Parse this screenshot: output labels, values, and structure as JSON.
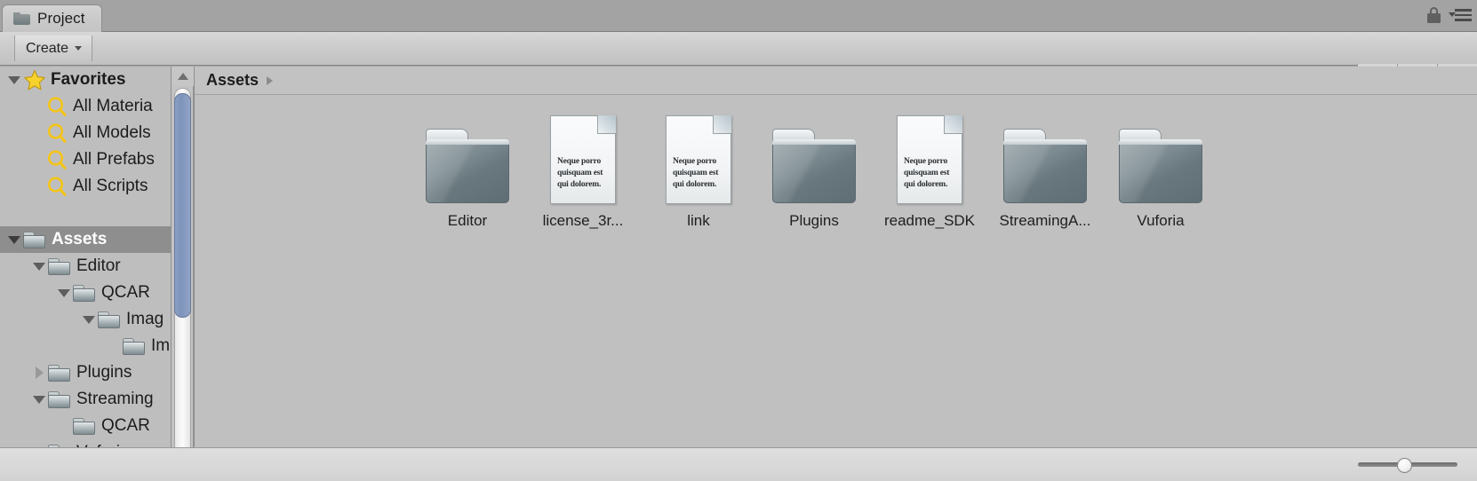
{
  "window": {
    "tab_label": "Project",
    "tab_icon": "folder-icon",
    "lock_icon": "lock-icon",
    "menu_icon": "hamburger-menu-icon"
  },
  "toolbar": {
    "create_label": "Create",
    "create_caret": "chevron-down-icon",
    "search": {
      "value": "",
      "placeholder": "",
      "icon": "search-icon"
    },
    "buttons": [
      {
        "name": "filter-by-type-button",
        "icon": "shapes-icon"
      },
      {
        "name": "filter-by-label-button",
        "icon": "tag-icon"
      },
      {
        "name": "filter-favorites-button",
        "icon": "star-icon"
      }
    ]
  },
  "sidebar": {
    "scrollbar": {
      "up_arrow": "scroll-up-arrow",
      "down_arrow": "scroll-down-arrow"
    },
    "items": [
      {
        "label": "Favorites",
        "icon": "star-icon",
        "indent": 0,
        "twisty": "open",
        "bold": true,
        "selected": false
      },
      {
        "label": "All Materia",
        "icon": "search-icon",
        "indent": 1,
        "twisty": "none",
        "bold": false,
        "selected": false
      },
      {
        "label": "All Models",
        "icon": "search-icon",
        "indent": 1,
        "twisty": "none",
        "bold": false,
        "selected": false
      },
      {
        "label": "All Prefabs",
        "icon": "search-icon",
        "indent": 1,
        "twisty": "none",
        "bold": false,
        "selected": false
      },
      {
        "label": "All Scripts",
        "icon": "search-icon",
        "indent": 1,
        "twisty": "none",
        "bold": false,
        "selected": false
      },
      {
        "label": "",
        "icon": "none",
        "indent": 0,
        "twisty": "none",
        "bold": false,
        "selected": false
      },
      {
        "label": "Assets",
        "icon": "folder-icon",
        "indent": 0,
        "twisty": "open",
        "bold": true,
        "selected": true
      },
      {
        "label": "Editor",
        "icon": "folder-icon",
        "indent": 1,
        "twisty": "open",
        "bold": false,
        "selected": false
      },
      {
        "label": "QCAR",
        "icon": "folder-icon",
        "indent": 2,
        "twisty": "open",
        "bold": false,
        "selected": false
      },
      {
        "label": "Imag",
        "icon": "folder-icon",
        "indent": 3,
        "twisty": "open",
        "bold": false,
        "selected": false
      },
      {
        "label": "Im",
        "icon": "folder-icon",
        "indent": 4,
        "twisty": "none",
        "bold": false,
        "selected": false
      },
      {
        "label": "Plugins",
        "icon": "folder-icon",
        "indent": 1,
        "twisty": "closed",
        "bold": false,
        "selected": false
      },
      {
        "label": "Streaming",
        "icon": "folder-icon",
        "indent": 1,
        "twisty": "open",
        "bold": false,
        "selected": false
      },
      {
        "label": "QCAR",
        "icon": "folder-icon",
        "indent": 2,
        "twisty": "none",
        "bold": false,
        "selected": false
      },
      {
        "label": "Vuforia",
        "icon": "folder-icon",
        "indent": 1,
        "twisty": "open",
        "bold": false,
        "selected": false
      }
    ]
  },
  "content": {
    "breadcrumb": {
      "label": "Assets",
      "arrow_icon": "chevron-right-icon"
    },
    "doc_preview_text": "Neque porro quisquam est qui dolorem.",
    "items": [
      {
        "label": "Editor",
        "type": "folder"
      },
      {
        "label": "license_3r...",
        "type": "document"
      },
      {
        "label": "link",
        "type": "document"
      },
      {
        "label": "Plugins",
        "type": "folder"
      },
      {
        "label": "readme_SDK",
        "type": "document"
      },
      {
        "label": "StreamingA...",
        "type": "folder"
      },
      {
        "label": "Vuforia",
        "type": "folder"
      }
    ]
  },
  "bottombar": {
    "zoom_slider": {
      "name": "icon-size-slider",
      "value": 40,
      "min": 0,
      "max": 100
    }
  },
  "colors": {
    "panel_bg": "#c0c0c0",
    "sidebar_bg": "#bebebe",
    "selection": "#8e8e8e",
    "toolbar": "#cbcbcb",
    "scroll_thumb": "#8093ba",
    "folder_icon": "#6c7a80",
    "favorite_yellow": "#f5cd2e"
  }
}
